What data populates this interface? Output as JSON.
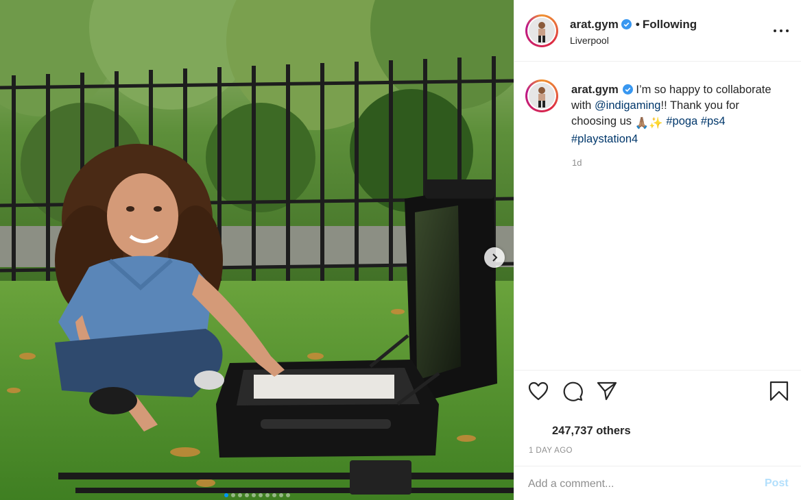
{
  "post": {
    "image_alt": "Child sitting on grass next to an open portable gaming console case",
    "carousel_index": 1,
    "carousel_count": 10
  },
  "header": {
    "username": "arat.gym",
    "separator": "•",
    "follow_status": "Following",
    "location": "Liverpool"
  },
  "caption": {
    "username": "arat.gym",
    "text_1": "I’m so happy to collaborate with ",
    "mention": "@indigaming",
    "text_2": "!! Thank you for choosing us ",
    "emojis": "🙏🏽✨",
    "hashtags": [
      "#poga",
      "#ps4",
      "#playstation4"
    ],
    "time": "1d"
  },
  "actions": {
    "like_icon": "heart-icon",
    "comment_icon": "comment-icon",
    "share_icon": "share-icon",
    "save_icon": "bookmark-icon"
  },
  "stats": {
    "likes": "247,737 others",
    "date": "1 DAY AGO"
  },
  "comment": {
    "placeholder": "Add a comment...",
    "post_label": "Post"
  },
  "colors": {
    "link": "#00376b",
    "verified": "#3897f0",
    "post_disabled": "#b2dffc",
    "muted": "#8e8e8e"
  }
}
